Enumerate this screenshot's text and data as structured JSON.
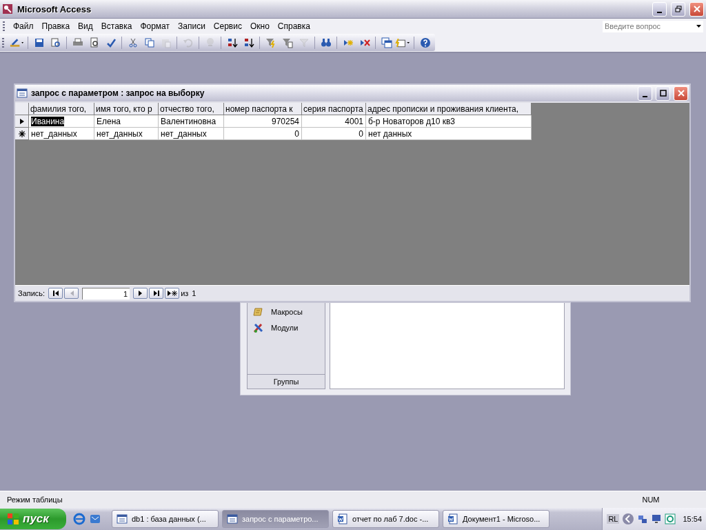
{
  "app": {
    "title": "Microsoft Access"
  },
  "menu": [
    {
      "label": "Файл"
    },
    {
      "label": "Правка"
    },
    {
      "label": "Вид"
    },
    {
      "label": "Вставка"
    },
    {
      "label": "Формат"
    },
    {
      "label": "Записи"
    },
    {
      "label": "Сервис"
    },
    {
      "label": "Окно"
    },
    {
      "label": "Справка"
    }
  ],
  "ask_field": {
    "placeholder": "Введите вопрос"
  },
  "toolbar": {
    "groups": [
      [
        {
          "kind": "design",
          "disabled": false
        }
      ],
      [
        {
          "kind": "save",
          "disabled": false
        },
        {
          "kind": "search-file",
          "disabled": false
        }
      ],
      [
        {
          "kind": "print",
          "disabled": false
        },
        {
          "kind": "preview",
          "disabled": false
        },
        {
          "kind": "spelling",
          "disabled": false
        }
      ],
      [
        {
          "kind": "cut",
          "disabled": false
        },
        {
          "kind": "copy",
          "disabled": false
        },
        {
          "kind": "paste",
          "disabled": true
        }
      ],
      [
        {
          "kind": "undo",
          "disabled": true
        }
      ],
      [
        {
          "kind": "hyperlink",
          "disabled": true
        }
      ],
      [
        {
          "kind": "sort-asc",
          "disabled": false
        },
        {
          "kind": "sort-desc",
          "disabled": false
        }
      ],
      [
        {
          "kind": "filter-selection",
          "disabled": false
        },
        {
          "kind": "filter-form",
          "disabled": false
        },
        {
          "kind": "filter-apply",
          "disabled": true
        }
      ],
      [
        {
          "kind": "find",
          "disabled": false
        }
      ],
      [
        {
          "kind": "new-record",
          "disabled": false
        },
        {
          "kind": "delete-record",
          "disabled": false
        }
      ],
      [
        {
          "kind": "db-window",
          "disabled": false
        },
        {
          "kind": "new-object",
          "disabled": false
        }
      ],
      [
        {
          "kind": "help",
          "disabled": false
        }
      ]
    ]
  },
  "query_window": {
    "title": "запрос с параметром : запрос на выборку",
    "columns": [
      {
        "label": "фамилия того,",
        "kind": "text"
      },
      {
        "label": "имя того, кто р",
        "kind": "text"
      },
      {
        "label": "отчество того,",
        "kind": "text"
      },
      {
        "label": "номер паспорта к",
        "kind": "number"
      },
      {
        "label": "серия паспорта",
        "kind": "number"
      },
      {
        "label": "адрес прописки и проживания клиента,",
        "kind": "text"
      }
    ],
    "rows": [
      {
        "kind": "current",
        "cells": [
          {
            "text": "Иванина",
            "selected": true
          },
          {
            "text": "Елена",
            "selected": false
          },
          {
            "text": "Валентиновна",
            "selected": false
          },
          {
            "text": "970254",
            "selected": false
          },
          {
            "text": "4001",
            "selected": false
          },
          {
            "text": "б-р Новаторов д10 кв3",
            "selected": false
          }
        ]
      },
      {
        "kind": "new",
        "cells": [
          {
            "text": "нет_данных",
            "selected": false
          },
          {
            "text": "нет_данных",
            "selected": false
          },
          {
            "text": "нет_данных",
            "selected": false
          },
          {
            "text": "0",
            "selected": false
          },
          {
            "text": "0",
            "selected": false
          },
          {
            "text": "нет данных",
            "selected": false
          }
        ]
      }
    ],
    "navigator": {
      "label": "Запись:",
      "value": "1",
      "of_label": "из",
      "total": "1",
      "buttons_before": [
        {
          "kind": "first",
          "disabled": false
        },
        {
          "kind": "prev",
          "disabled": true
        }
      ],
      "buttons_after": [
        {
          "kind": "next",
          "disabled": false
        },
        {
          "kind": "last",
          "disabled": false
        },
        {
          "kind": "new",
          "disabled": false
        }
      ]
    }
  },
  "database_window": {
    "objects": [
      {
        "label": "Макросы",
        "kind": "macros"
      },
      {
        "label": "Модули",
        "kind": "modules"
      }
    ],
    "groups_label": "Группы"
  },
  "status_bar": {
    "text": "Режим таблицы",
    "indicators": [
      "NUM"
    ]
  },
  "taskbar": {
    "start": "пуск",
    "tasks": [
      {
        "label": "db1 : база данных (...",
        "kind": "access",
        "selected": false
      },
      {
        "label": "запрос с параметро...",
        "kind": "access",
        "selected": true
      },
      {
        "label": "отчет по лаб 7.doc -...",
        "kind": "word",
        "selected": false
      },
      {
        "label": "Документ1 - Microso...",
        "kind": "word",
        "selected": false
      }
    ],
    "language": "RL",
    "time": "15:54"
  }
}
